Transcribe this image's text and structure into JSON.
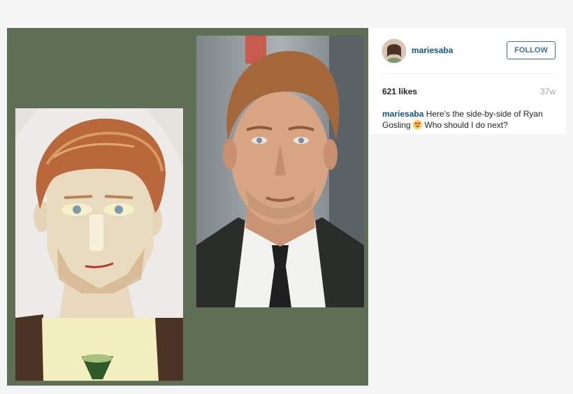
{
  "post": {
    "images": [
      "sandwich-portrait",
      "actor-portrait"
    ],
    "colors": {
      "frame_bg": "#5f6f55",
      "page_bg": "#f5f5f5"
    }
  },
  "header": {
    "username": "mariesaba",
    "follow_label": "FOLLOW"
  },
  "stats": {
    "likes": "621 likes",
    "time": "37w"
  },
  "caption": {
    "username": "mariesaba",
    "text_before": "Here's the side-by-side of Ryan Gosling",
    "emoji": "heart-eyes-emoji",
    "text_after": "Who should I do next?"
  },
  "colors": {
    "link": "#125688",
    "follow": "#3f729b"
  }
}
